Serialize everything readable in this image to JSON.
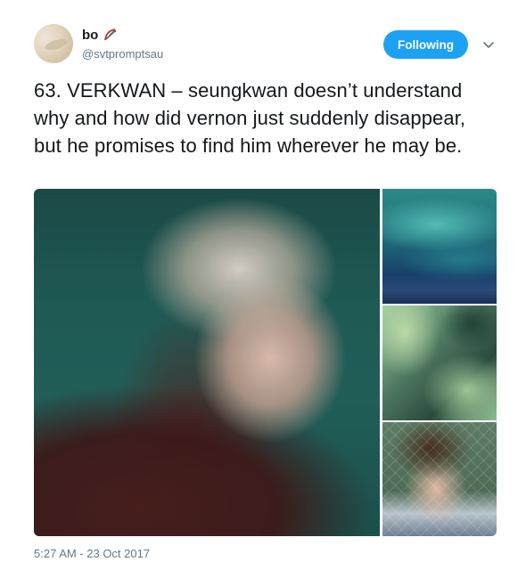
{
  "user": {
    "display_name": "bo",
    "handle": "@svtpromptsau",
    "name_emoji_icon": "bow-and-arrow-icon"
  },
  "follow_button": {
    "label": "Following"
  },
  "tweet": {
    "text": "63. VERKWAN – seungkwan doesn’t understand why and how did vernon just suddenly disappear, but he promises to find him wherever he may be.",
    "timestamp": "5:27 AM - 23 Oct 2017"
  },
  "colors": {
    "accent": "#1da1f2",
    "text": "#14171a",
    "muted": "#657786"
  }
}
